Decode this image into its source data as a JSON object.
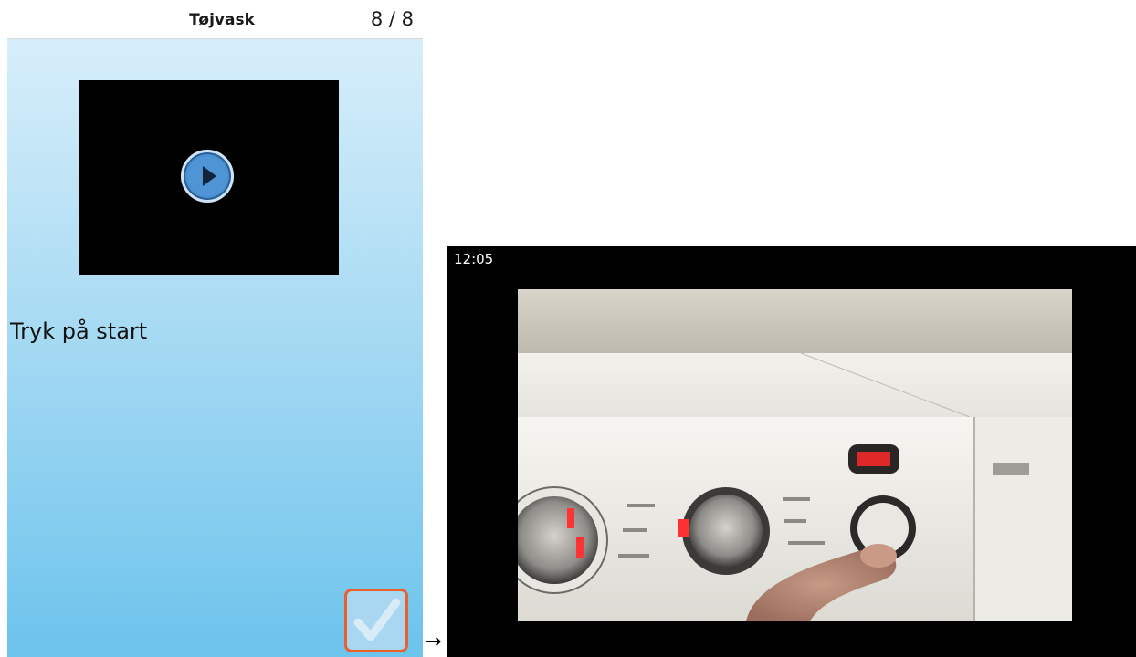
{
  "phone": {
    "title": "Tøjvask",
    "page_counter": "8 / 8",
    "video_thumbnail_icon": "play-icon",
    "instruction": "Tryk på start",
    "confirm_icon": "checkmark-icon",
    "colors": {
      "gradient_top": "#d7eefa",
      "gradient_bottom": "#6cc3ec",
      "confirm_border": "#e8602c",
      "play_button": "#4a8fd0"
    }
  },
  "transition": {
    "arrow": "→"
  },
  "player": {
    "clock": "12:05",
    "background": "#000000"
  }
}
